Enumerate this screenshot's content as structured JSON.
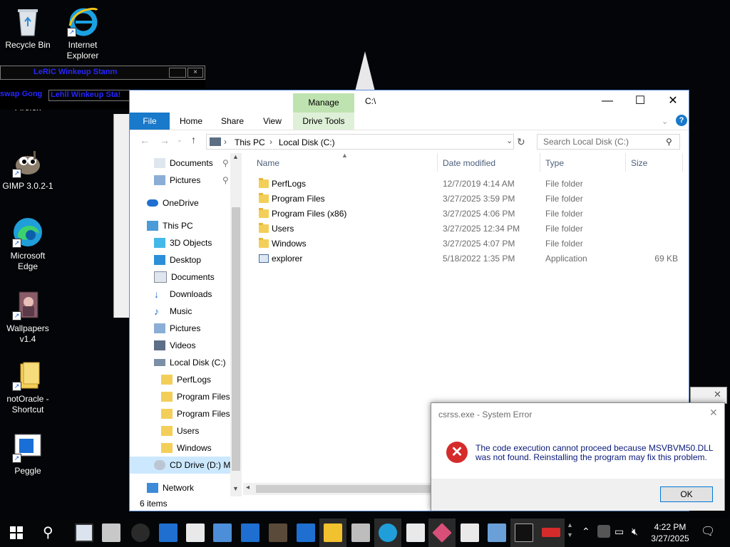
{
  "desktop": {
    "icons": [
      {
        "label": "Recycle Bin",
        "icon": "recycle-bin-icon"
      },
      {
        "label": "Internet Explorer",
        "icon": "internet-explorer-icon"
      },
      {
        "label": "Firefox",
        "icon": "firefox-icon"
      },
      {
        "label": "GIMP 3.0.2-1",
        "icon": "gimp-icon"
      },
      {
        "label": "Microsoft Edge",
        "icon": "edge-icon"
      },
      {
        "label": "Wallpapers v1.4",
        "icon": "wallpapers-icon"
      },
      {
        "label": "notOracle - Shortcut",
        "icon": "folder-icon"
      },
      {
        "label": "Peggle",
        "icon": "peggle-icon"
      }
    ],
    "winamp": {
      "title_top": "LeRIC  Winkeup Stanm",
      "title_mid": "Lehll  Winkeup Sta!",
      "left_text": "swap Gong"
    }
  },
  "explorer": {
    "title": "C:\\",
    "ribbon": {
      "manage": "Manage",
      "drive_tools": "Drive Tools",
      "tabs": [
        "File",
        "Home",
        "Share",
        "View"
      ]
    },
    "address": {
      "parts": [
        "This PC",
        "Local Disk (C:)"
      ]
    },
    "search_placeholder": "Search Local Disk (C:)",
    "nav": [
      {
        "label": "Documents",
        "pinned": true
      },
      {
        "label": "Pictures",
        "pinned": true
      },
      {
        "label": "OneDrive"
      },
      {
        "label": "This PC"
      },
      {
        "label": "3D Objects"
      },
      {
        "label": "Desktop"
      },
      {
        "label": "Documents"
      },
      {
        "label": "Downloads"
      },
      {
        "label": "Music"
      },
      {
        "label": "Pictures"
      },
      {
        "label": "Videos"
      },
      {
        "label": "Local Disk (C:)"
      },
      {
        "label": "PerfLogs"
      },
      {
        "label": "Program Files"
      },
      {
        "label": "Program Files ("
      },
      {
        "label": "Users"
      },
      {
        "label": "Windows"
      },
      {
        "label": "CD Drive (D:) Mc"
      },
      {
        "label": "Network"
      }
    ],
    "columns": [
      "Name",
      "Date modified",
      "Type",
      "Size"
    ],
    "rows": [
      {
        "name": "PerfLogs",
        "date": "12/7/2019 4:14 AM",
        "type": "File folder",
        "size": ""
      },
      {
        "name": "Program Files",
        "date": "3/27/2025 3:59 PM",
        "type": "File folder",
        "size": ""
      },
      {
        "name": "Program Files (x86)",
        "date": "3/27/2025 4:06 PM",
        "type": "File folder",
        "size": ""
      },
      {
        "name": "Users",
        "date": "3/27/2025 12:34 PM",
        "type": "File folder",
        "size": ""
      },
      {
        "name": "Windows",
        "date": "3/27/2025 4:07 PM",
        "type": "File folder",
        "size": ""
      },
      {
        "name": "explorer",
        "date": "5/18/2022 1:35 PM",
        "type": "Application",
        "size": "69 KB"
      }
    ],
    "status": "6 items"
  },
  "error_dialog": {
    "title": "csrss.exe - System Error",
    "message": "The code execution cannot proceed because MSVBVM50.DLL was not found. Reinstalling the program may fix this problem.",
    "ok": "OK"
  },
  "taskbar": {
    "time": "4:22 PM",
    "date": "3/27/2025"
  }
}
